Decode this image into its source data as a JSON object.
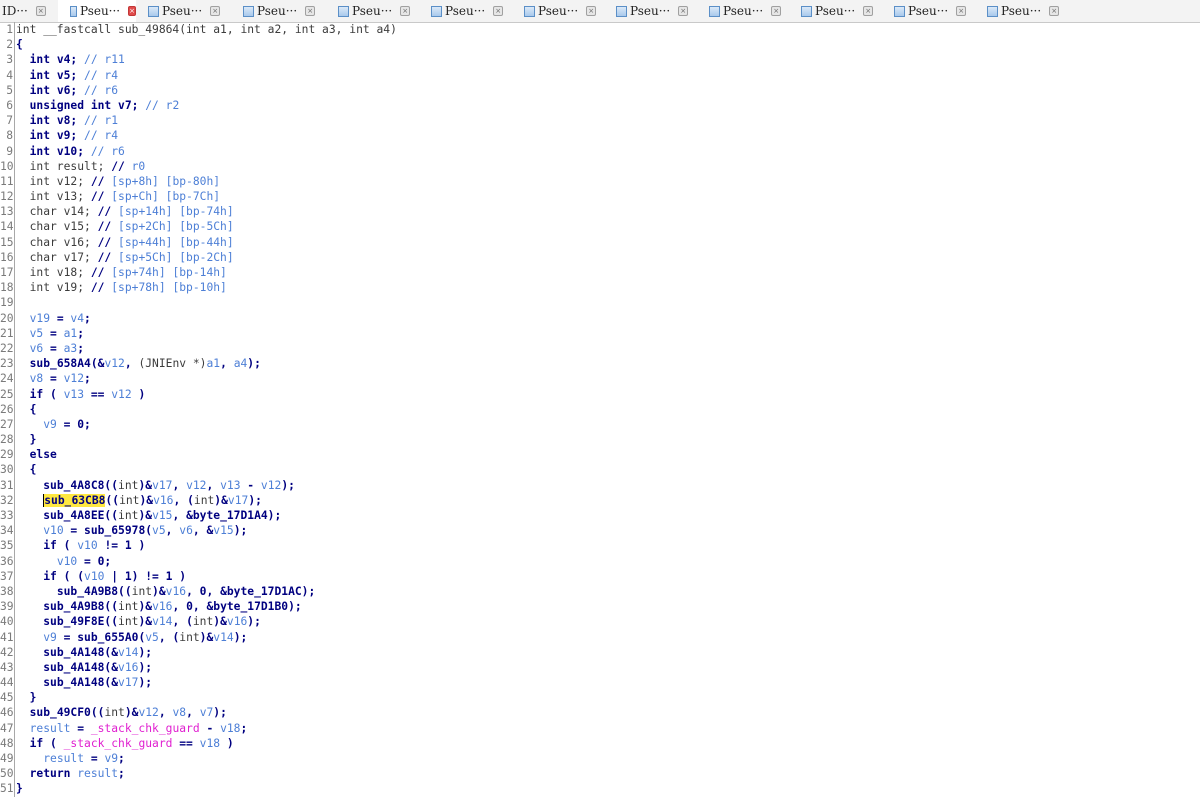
{
  "tabs": [
    {
      "label": "ID···",
      "active": false,
      "icon": "doc-icon"
    },
    {
      "label": "Pseu···",
      "active": true,
      "icon": "pseudocode-icon"
    },
    {
      "label": "Pseu···",
      "active": false,
      "icon": "pseudocode-icon"
    },
    {
      "label": "Pseu···",
      "active": false,
      "icon": "pseudocode-icon"
    },
    {
      "label": "Pseu···",
      "active": false,
      "icon": "pseudocode-icon"
    },
    {
      "label": "Pseu···",
      "active": false,
      "icon": "pseudocode-icon"
    },
    {
      "label": "Pseu···",
      "active": false,
      "icon": "pseudocode-icon"
    },
    {
      "label": "Pseu···",
      "active": false,
      "icon": "pseudocode-icon"
    },
    {
      "label": "Pseu···",
      "active": false,
      "icon": "pseudocode-icon"
    },
    {
      "label": "Pseu···",
      "active": false,
      "icon": "pseudocode-icon"
    },
    {
      "label": "Pseu···",
      "active": false,
      "icon": "pseudocode-icon"
    },
    {
      "label": "Pseu···",
      "active": false,
      "icon": "pseudocode-icon"
    }
  ],
  "tab_close_glyph": "×",
  "colors": {
    "highlight": "#ffe840",
    "keyword": "#000080",
    "variable": "#4d7fd6",
    "guard": "#e020d0",
    "active_close": "#e04b4b"
  },
  "code": [
    {
      "n": "1",
      "t": [
        [
          "plain",
          "int __fastcall sub_49864(int a1, int a2, int a3, int a4)"
        ]
      ]
    },
    {
      "n": "2",
      "t": [
        [
          "kw",
          "{"
        ]
      ]
    },
    {
      "n": "3",
      "t": [
        [
          "plain",
          "  "
        ],
        [
          "kw",
          "int v4;"
        ],
        [
          "cm",
          " // r11"
        ]
      ]
    },
    {
      "n": "4",
      "t": [
        [
          "plain",
          "  "
        ],
        [
          "kw",
          "int v5;"
        ],
        [
          "cm",
          " // r4"
        ]
      ]
    },
    {
      "n": "5",
      "t": [
        [
          "plain",
          "  "
        ],
        [
          "kw",
          "int v6;"
        ],
        [
          "cm",
          " // r6"
        ]
      ]
    },
    {
      "n": "6",
      "t": [
        [
          "plain",
          "  "
        ],
        [
          "kw",
          "unsigned int v7;"
        ],
        [
          "cm",
          " // r2"
        ]
      ]
    },
    {
      "n": "7",
      "t": [
        [
          "plain",
          "  "
        ],
        [
          "kw",
          "int v8;"
        ],
        [
          "cm",
          " // r1"
        ]
      ]
    },
    {
      "n": "8",
      "t": [
        [
          "plain",
          "  "
        ],
        [
          "kw",
          "int v9;"
        ],
        [
          "cm",
          " // r4"
        ]
      ]
    },
    {
      "n": "9",
      "t": [
        [
          "plain",
          "  "
        ],
        [
          "kw",
          "int v10;"
        ],
        [
          "cm",
          " // r6"
        ]
      ]
    },
    {
      "n": "10",
      "t": [
        [
          "plain",
          "  int result; "
        ],
        [
          "kw",
          "//"
        ],
        [
          "cm",
          " r0"
        ]
      ]
    },
    {
      "n": "11",
      "t": [
        [
          "plain",
          "  int v12; "
        ],
        [
          "kw",
          "//"
        ],
        [
          "cm",
          " [sp+8h] [bp-80h]"
        ]
      ]
    },
    {
      "n": "12",
      "t": [
        [
          "plain",
          "  int v13; "
        ],
        [
          "kw",
          "//"
        ],
        [
          "cm",
          " [sp+Ch] [bp-7Ch]"
        ]
      ]
    },
    {
      "n": "13",
      "t": [
        [
          "plain",
          "  char v14; "
        ],
        [
          "kw",
          "//"
        ],
        [
          "cm",
          " [sp+14h] [bp-74h]"
        ]
      ]
    },
    {
      "n": "14",
      "t": [
        [
          "plain",
          "  char v15; "
        ],
        [
          "kw",
          "//"
        ],
        [
          "cm",
          " [sp+2Ch] [bp-5Ch]"
        ]
      ]
    },
    {
      "n": "15",
      "t": [
        [
          "plain",
          "  char v16; "
        ],
        [
          "kw",
          "//"
        ],
        [
          "cm",
          " [sp+44h] [bp-44h]"
        ]
      ]
    },
    {
      "n": "16",
      "t": [
        [
          "plain",
          "  char v17; "
        ],
        [
          "kw",
          "//"
        ],
        [
          "cm",
          " [sp+5Ch] [bp-2Ch]"
        ]
      ]
    },
    {
      "n": "17",
      "t": [
        [
          "plain",
          "  int v18; "
        ],
        [
          "kw",
          "//"
        ],
        [
          "cm",
          " [sp+74h] [bp-14h]"
        ]
      ]
    },
    {
      "n": "18",
      "t": [
        [
          "plain",
          "  int v19; "
        ],
        [
          "kw",
          "//"
        ],
        [
          "cm",
          " [sp+78h] [bp-10h]"
        ]
      ]
    },
    {
      "n": "19",
      "t": [
        [
          "plain",
          ""
        ]
      ]
    },
    {
      "n": "20",
      "t": [
        [
          "plain",
          "  "
        ],
        [
          "var",
          "v19"
        ],
        [
          "op",
          " = "
        ],
        [
          "var",
          "v4"
        ],
        [
          "op",
          ";"
        ]
      ]
    },
    {
      "n": "21",
      "t": [
        [
          "plain",
          "  "
        ],
        [
          "var",
          "v5"
        ],
        [
          "op",
          " = "
        ],
        [
          "var",
          "a1"
        ],
        [
          "op",
          ";"
        ]
      ]
    },
    {
      "n": "22",
      "t": [
        [
          "plain",
          "  "
        ],
        [
          "var",
          "v6"
        ],
        [
          "op",
          " = "
        ],
        [
          "var",
          "a3"
        ],
        [
          "op",
          ";"
        ]
      ]
    },
    {
      "n": "23",
      "t": [
        [
          "plain",
          "  "
        ],
        [
          "fn",
          "sub_658A4(&"
        ],
        [
          "var",
          "v12"
        ],
        [
          "op",
          ", "
        ],
        [
          "plain",
          "(JNIEnv *)"
        ],
        [
          "var",
          "a1"
        ],
        [
          "op",
          ", "
        ],
        [
          "var",
          "a4"
        ],
        [
          "op",
          ");"
        ]
      ]
    },
    {
      "n": "24",
      "t": [
        [
          "plain",
          "  "
        ],
        [
          "var",
          "v8"
        ],
        [
          "op",
          " = "
        ],
        [
          "var",
          "v12"
        ],
        [
          "op",
          ";"
        ]
      ]
    },
    {
      "n": "25",
      "t": [
        [
          "plain",
          "  "
        ],
        [
          "kw",
          "if ( "
        ],
        [
          "var",
          "v13"
        ],
        [
          "op",
          " == "
        ],
        [
          "var",
          "v12"
        ],
        [
          "op",
          " )"
        ]
      ]
    },
    {
      "n": "26",
      "t": [
        [
          "plain",
          "  "
        ],
        [
          "kw",
          "{"
        ]
      ]
    },
    {
      "n": "27",
      "t": [
        [
          "plain",
          "    "
        ],
        [
          "var",
          "v9"
        ],
        [
          "op",
          " = 0;"
        ]
      ]
    },
    {
      "n": "28",
      "t": [
        [
          "plain",
          "  "
        ],
        [
          "kw",
          "}"
        ]
      ]
    },
    {
      "n": "29",
      "t": [
        [
          "plain",
          "  "
        ],
        [
          "kw",
          "else"
        ]
      ]
    },
    {
      "n": "30",
      "t": [
        [
          "plain",
          "  "
        ],
        [
          "kw",
          "{"
        ]
      ]
    },
    {
      "n": "31",
      "t": [
        [
          "plain",
          "    "
        ],
        [
          "fn",
          "sub_4A8C8(("
        ],
        [
          "plain",
          "int"
        ],
        [
          "op",
          ")&"
        ],
        [
          "var",
          "v17"
        ],
        [
          "op",
          ", "
        ],
        [
          "var",
          "v12"
        ],
        [
          "op",
          ", "
        ],
        [
          "var",
          "v13"
        ],
        [
          "op",
          " - "
        ],
        [
          "var",
          "v12"
        ],
        [
          "op",
          ");"
        ]
      ]
    },
    {
      "n": "32",
      "t": [
        [
          "plain",
          "    "
        ],
        [
          "hl",
          "sub_"
        ],
        [
          "hlc",
          "63CB8"
        ],
        [
          "fn",
          "(("
        ],
        [
          "plain",
          "int"
        ],
        [
          "op",
          ")&"
        ],
        [
          "var",
          "v16"
        ],
        [
          "op",
          ", ("
        ],
        [
          "plain",
          "int"
        ],
        [
          "op",
          ")&"
        ],
        [
          "var",
          "v17"
        ],
        [
          "op",
          ");"
        ]
      ]
    },
    {
      "n": "33",
      "t": [
        [
          "plain",
          "    "
        ],
        [
          "fn",
          "sub_4A8EE(("
        ],
        [
          "plain",
          "int"
        ],
        [
          "op",
          ")&"
        ],
        [
          "var",
          "v15"
        ],
        [
          "op",
          ", &byte_17D1A4);"
        ]
      ]
    },
    {
      "n": "34",
      "t": [
        [
          "plain",
          "    "
        ],
        [
          "var",
          "v10"
        ],
        [
          "op",
          " = sub_65978("
        ],
        [
          "var",
          "v5"
        ],
        [
          "op",
          ", "
        ],
        [
          "var",
          "v6"
        ],
        [
          "op",
          ", &"
        ],
        [
          "var",
          "v15"
        ],
        [
          "op",
          ");"
        ]
      ]
    },
    {
      "n": "35",
      "t": [
        [
          "plain",
          "    "
        ],
        [
          "kw",
          "if ( "
        ],
        [
          "var",
          "v10"
        ],
        [
          "op",
          " != 1 )"
        ]
      ]
    },
    {
      "n": "36",
      "t": [
        [
          "plain",
          "      "
        ],
        [
          "var",
          "v10"
        ],
        [
          "op",
          " = 0;"
        ]
      ]
    },
    {
      "n": "37",
      "t": [
        [
          "plain",
          "    "
        ],
        [
          "kw",
          "if ( ("
        ],
        [
          "var",
          "v10"
        ],
        [
          "op",
          " | 1) != 1 )"
        ]
      ]
    },
    {
      "n": "38",
      "t": [
        [
          "plain",
          "      "
        ],
        [
          "fn",
          "sub_4A9B8(("
        ],
        [
          "plain",
          "int"
        ],
        [
          "op",
          ")&"
        ],
        [
          "var",
          "v16"
        ],
        [
          "op",
          ", 0, &byte_17D1AC);"
        ]
      ]
    },
    {
      "n": "39",
      "t": [
        [
          "plain",
          "    "
        ],
        [
          "fn",
          "sub_4A9B8(("
        ],
        [
          "plain",
          "int"
        ],
        [
          "op",
          ")&"
        ],
        [
          "var",
          "v16"
        ],
        [
          "op",
          ", 0, &byte_17D1B0);"
        ]
      ]
    },
    {
      "n": "40",
      "t": [
        [
          "plain",
          "    "
        ],
        [
          "fn",
          "sub_49F8E(("
        ],
        [
          "plain",
          "int"
        ],
        [
          "op",
          ")&"
        ],
        [
          "var",
          "v14"
        ],
        [
          "op",
          ", ("
        ],
        [
          "plain",
          "int"
        ],
        [
          "op",
          ")&"
        ],
        [
          "var",
          "v16"
        ],
        [
          "op",
          ");"
        ]
      ]
    },
    {
      "n": "41",
      "t": [
        [
          "plain",
          "    "
        ],
        [
          "var",
          "v9"
        ],
        [
          "op",
          " = sub_655A0("
        ],
        [
          "var",
          "v5"
        ],
        [
          "op",
          ", ("
        ],
        [
          "plain",
          "int"
        ],
        [
          "op",
          ")&"
        ],
        [
          "var",
          "v14"
        ],
        [
          "op",
          ");"
        ]
      ]
    },
    {
      "n": "42",
      "t": [
        [
          "plain",
          "    "
        ],
        [
          "fn",
          "sub_4A148(&"
        ],
        [
          "var",
          "v14"
        ],
        [
          "op",
          ");"
        ]
      ]
    },
    {
      "n": "43",
      "t": [
        [
          "plain",
          "    "
        ],
        [
          "fn",
          "sub_4A148(&"
        ],
        [
          "var",
          "v16"
        ],
        [
          "op",
          ");"
        ]
      ]
    },
    {
      "n": "44",
      "t": [
        [
          "plain",
          "    "
        ],
        [
          "fn",
          "sub_4A148(&"
        ],
        [
          "var",
          "v17"
        ],
        [
          "op",
          ");"
        ]
      ]
    },
    {
      "n": "45",
      "t": [
        [
          "plain",
          "  "
        ],
        [
          "kw",
          "}"
        ]
      ]
    },
    {
      "n": "46",
      "t": [
        [
          "plain",
          "  "
        ],
        [
          "fn",
          "sub_49CF0(("
        ],
        [
          "plain",
          "int"
        ],
        [
          "op",
          ")&"
        ],
        [
          "var",
          "v12"
        ],
        [
          "op",
          ", "
        ],
        [
          "var",
          "v8"
        ],
        [
          "op",
          ", "
        ],
        [
          "var",
          "v7"
        ],
        [
          "op",
          ");"
        ]
      ]
    },
    {
      "n": "47",
      "t": [
        [
          "plain",
          "  "
        ],
        [
          "var",
          "result"
        ],
        [
          "op",
          " = "
        ],
        [
          "guard",
          "_stack_chk_guard"
        ],
        [
          "op",
          " - "
        ],
        [
          "var",
          "v18"
        ],
        [
          "op",
          ";"
        ]
      ]
    },
    {
      "n": "48",
      "t": [
        [
          "plain",
          "  "
        ],
        [
          "kw",
          "if ( "
        ],
        [
          "guard",
          "_stack_chk_guard"
        ],
        [
          "op",
          " == "
        ],
        [
          "var",
          "v18"
        ],
        [
          "op",
          " )"
        ]
      ]
    },
    {
      "n": "49",
      "t": [
        [
          "plain",
          "    "
        ],
        [
          "var",
          "result"
        ],
        [
          "op",
          " = "
        ],
        [
          "var",
          "v9"
        ],
        [
          "op",
          ";"
        ]
      ]
    },
    {
      "n": "50",
      "t": [
        [
          "plain",
          "  "
        ],
        [
          "kw",
          "return "
        ],
        [
          "var",
          "result"
        ],
        [
          "op",
          ";"
        ]
      ]
    },
    {
      "n": "51",
      "t": [
        [
          "kw",
          "}"
        ]
      ]
    }
  ]
}
